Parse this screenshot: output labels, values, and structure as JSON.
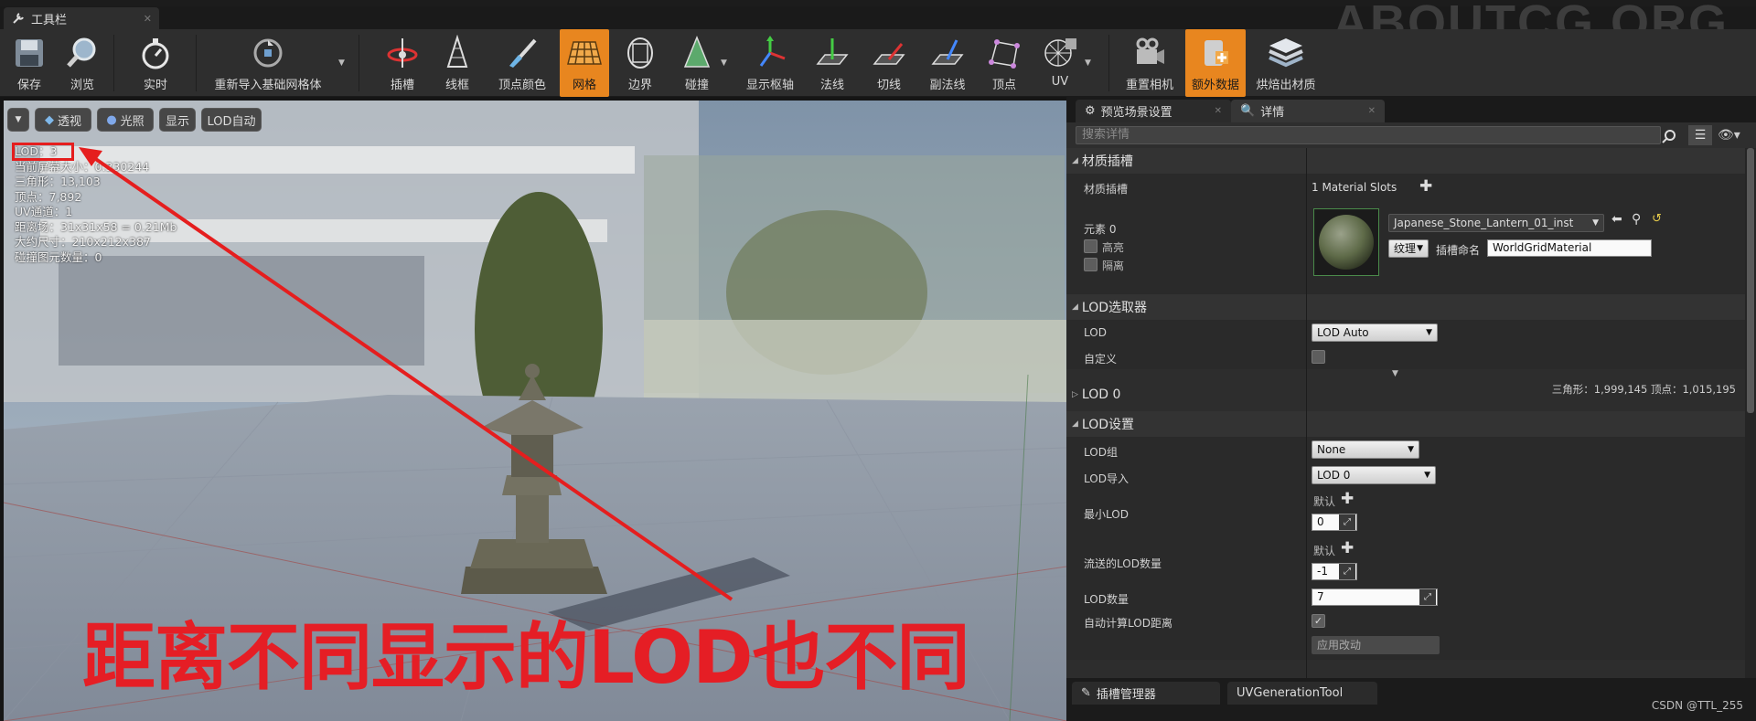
{
  "window": {
    "tab_title": "工具栏",
    "watermark": "ABOUTCG.ORG"
  },
  "toolbar": {
    "save": "保存",
    "browse": "浏览",
    "realtime": "实时",
    "reimport": "重新导入基础网格体",
    "socket": "插槽",
    "wireframe": "线框",
    "vertex_color": "顶点颜色",
    "grid": "网格",
    "bounds": "边界",
    "collision": "碰撞",
    "pivot": "显示枢轴",
    "normals": "法线",
    "tangents": "切线",
    "binormals": "副法线",
    "vertices": "顶点",
    "uv": "UV",
    "reset_camera": "重置相机",
    "additional_data": "额外数据",
    "bake_materials": "烘焙出材质"
  },
  "viewport": {
    "buttons": {
      "perspective": "透视",
      "lighting": "光照",
      "show": "显示",
      "lod_auto": "LOD自动"
    },
    "stats": [
      "LOD：3",
      "当前屏幕大小：0.330244",
      "三角形：13,103",
      "顶点：7,892",
      "UV通道：1",
      "距离场：31x31x58 = 0.21Mb",
      "大约尺寸：210x212x387",
      "碰撞图元数量：0"
    ],
    "caption": "距离不同显示的LOD也不同"
  },
  "panel": {
    "tabs": {
      "preview_scene": "预览场景设置",
      "details": "详情"
    },
    "search_placeholder": "搜索详情",
    "material_slots": {
      "header": "材质插槽",
      "label": "材质插槽",
      "count": "1 Material Slots",
      "element": "元素 0",
      "highlight": "高亮",
      "isolate": "隔离",
      "material_name": "Japanese_Stone_Lantern_01_inst",
      "texture": "纹理",
      "slot_name_label": "插槽命名",
      "slot_name": "WorldGridMaterial"
    },
    "lod_picker": {
      "header": "LOD选取器",
      "lod_label": "LOD",
      "lod_value": "LOD Auto",
      "custom_label": "自定义"
    },
    "lod0": {
      "header": "LOD 0",
      "stats": "三角形：1,999,145    顶点：1,015,195"
    },
    "lod_settings": {
      "header": "LOD设置",
      "lod_group_label": "LOD组",
      "lod_group": "None",
      "lod_import_label": "LOD导入",
      "lod_import": "LOD 0",
      "min_lod_label": "最小LOD",
      "default": "默认",
      "min_lod": "0",
      "streamed_lod_label": "流送的LOD数量",
      "streamed_lod": "-1",
      "lod_count_label": "LOD数量",
      "lod_count": "7",
      "auto_lod_label": "自动计算LOD距离",
      "apply": "应用改动"
    },
    "bottom_tabs": {
      "socket_manager": "插槽管理器",
      "uv_tool": "UVGenerationTool"
    }
  },
  "credit": "CSDN @TTL_255"
}
